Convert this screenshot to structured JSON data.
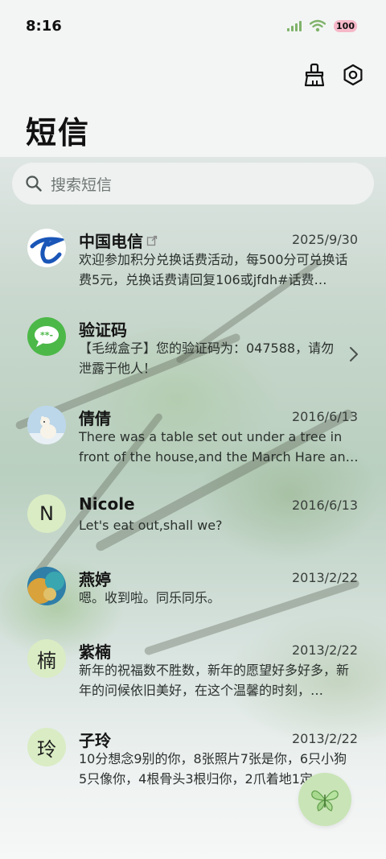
{
  "status": {
    "time": "8:16",
    "battery": "100"
  },
  "header": {
    "title": "短信"
  },
  "search": {
    "placeholder": "搜索短信"
  },
  "messages": [
    {
      "name": "中国电信",
      "date": "2025/9/30",
      "preview": "欢迎参加积分兑换话费活动，每500分可兑换话费5元，兑换话费请回复106或jfdh#话费…",
      "avatar": "china-telecom-logo"
    },
    {
      "name": "验证码",
      "date": "",
      "preview": "【毛绒盒子】您的验证码为：047588，请勿泄露于他人！",
      "avatar": "message-bubble"
    },
    {
      "name": "倩倩",
      "date": "2016/6/13",
      "preview": "There was a table set out under a tree in front of the house,and the March Hare an…",
      "avatar": "polar-bear-photo"
    },
    {
      "name": "Nicole",
      "date": "2016/6/13",
      "preview": "Let's eat out,shall we?",
      "avatar_letter": "N"
    },
    {
      "name": "燕婷",
      "date": "2013/2/22",
      "preview": "嗯。收到啦。同乐同乐。",
      "avatar": "colorful-photo"
    },
    {
      "name": "紫楠",
      "date": "2013/2/22",
      "preview": "新年的祝福数不胜数，新年的愿望好多好多，新年的问候依旧美好，在这个温馨的时刻，…",
      "avatar_letter": "楠"
    },
    {
      "name": "子玲",
      "date": "2013/2/22",
      "preview": "10分想念9别的你，8张照片7张是你，6只小狗5只像你，4根骨头3根归你，2爪着地1定…",
      "avatar_letter": "玲"
    }
  ],
  "colors": {
    "accent": "#4cb848",
    "avatar_bg": "#d9ecc4",
    "telecom_blue": "#1a56b8"
  }
}
